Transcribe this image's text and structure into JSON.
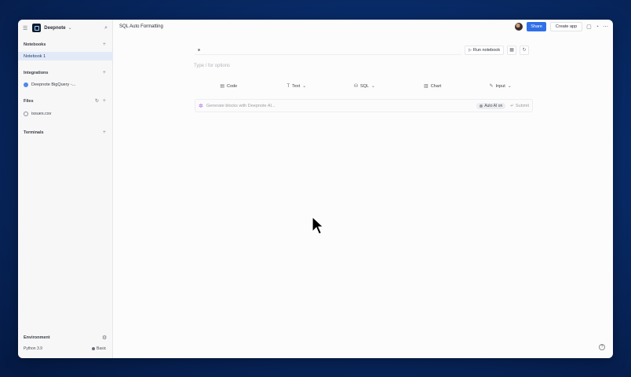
{
  "header": {
    "workspace": "Deepnote",
    "title": "SQL Auto Formatting",
    "share_label": "Share",
    "create_app_label": "Create app"
  },
  "sidebar": {
    "notebooks_title": "Notebooks",
    "notebooks": [
      "Notebook 1"
    ],
    "integrations_title": "Integrations",
    "integrations": [
      "Deepnote BigQuery -..."
    ],
    "files_title": "Files",
    "files": [
      "issues.csv"
    ],
    "terminals_title": "Terminals",
    "environment_title": "Environment",
    "python_version": "Python 3.9",
    "machine": "Basic"
  },
  "notebook": {
    "run_label": "Run notebook",
    "placeholder": "Type / for options",
    "blocks": [
      {
        "icon": "code-icon",
        "label": "Code",
        "glyph": "▤",
        "dropdown": false
      },
      {
        "icon": "text-icon",
        "label": "Text",
        "glyph": "T",
        "dropdown": true
      },
      {
        "icon": "sql-icon",
        "label": "SQL",
        "glyph": "⛁",
        "dropdown": true
      },
      {
        "icon": "chart-icon",
        "label": "Chart",
        "glyph": "▥",
        "dropdown": false
      },
      {
        "icon": "input-icon",
        "label": "Input",
        "glyph": "✎",
        "dropdown": true
      }
    ],
    "ai_prompt": "Generate blocks with Deepnote AI...",
    "ai_badge": "Auto AI on",
    "submit_label": "Submit"
  }
}
